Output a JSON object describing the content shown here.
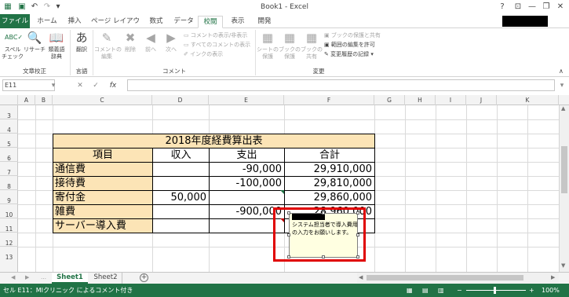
{
  "titlebar": {
    "title": "Book1 - Excel",
    "help": "?",
    "minimize": "—",
    "restore": "❐",
    "close": "✕"
  },
  "tabs": [
    "ファイル",
    "ホーム",
    "挿入",
    "ページ レイアウト",
    "数式",
    "データ",
    "校閲",
    "表示",
    "開発"
  ],
  "ribbon": {
    "spelling": "スペル\nチェック",
    "research": "リサーチ",
    "thesaurus": "類義語\n辞典",
    "translate": "翻訳",
    "new_comment": "コメントの\n編集",
    "delete": "削除",
    "previous": "前へ",
    "next": "次へ",
    "show_hide_comment": "コメントの表示/非表示",
    "show_all_comments": "すべてのコメントの表示",
    "show_ink": "インクの表示",
    "protect_sheet": "シートの\n保護",
    "protect_workbook": "ブックの\n保護",
    "share_workbook": "ブックの\n共有",
    "protect_share": "ブックの保護と共有",
    "allow_edit_ranges": "範囲の編集を許可",
    "track_changes": "変更履歴の記録 ▾",
    "groups": {
      "proofing": "文章校正",
      "language": "言語",
      "comments": "コメント",
      "changes": "変更"
    }
  },
  "formula_bar": {
    "name_box": "E11",
    "fx": "fx",
    "cancel": "✕",
    "enter": "✓"
  },
  "columns": [
    "A",
    "B",
    "C",
    "D",
    "E",
    "F",
    "G",
    "H",
    "I",
    "J",
    "K"
  ],
  "rows": [
    "3",
    "4",
    "5",
    "6",
    "7",
    "8",
    "9",
    "10",
    "11",
    "12",
    "13"
  ],
  "table": {
    "title": "2018年度経費算出表",
    "headers": [
      "項目",
      "収入",
      "支出",
      "合計"
    ],
    "rows": [
      {
        "item": "通信費",
        "income": "",
        "expense": "-90,000",
        "total": "29,910,000"
      },
      {
        "item": "接待費",
        "income": "",
        "expense": "-100,000",
        "total": "29,810,000"
      },
      {
        "item": "寄付金",
        "income": "50,000",
        "expense": "",
        "total": "29,860,000"
      },
      {
        "item": "雑費",
        "income": "",
        "expense": "-900,000",
        "total": "28,960,000"
      },
      {
        "item": "サーバー導入費",
        "income": "",
        "expense": "",
        "total": ""
      }
    ]
  },
  "comment": {
    "text": "システム担当者で導入費用の入力をお願いします。"
  },
  "sheet_tabs": [
    "Sheet1",
    "Sheet2"
  ],
  "statusbar": {
    "text": "セル E11：MIクリニック によるコメント付き",
    "zoom": "100%"
  }
}
